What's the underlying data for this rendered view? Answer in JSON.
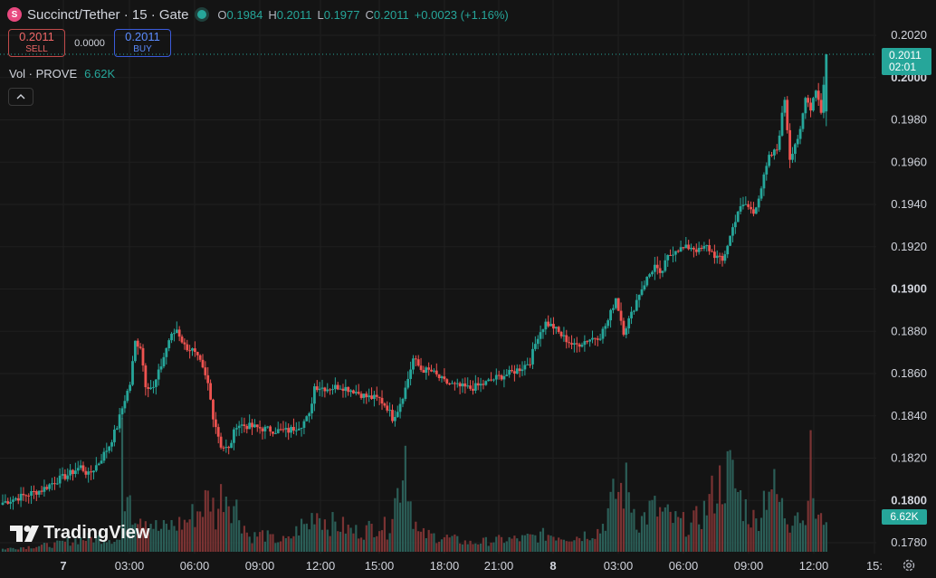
{
  "header": {
    "logo_letter": "S",
    "title": "Succinct/Tether · 15 · Gate",
    "ohlc": [
      {
        "key": "O",
        "value": "0.1984"
      },
      {
        "key": "H",
        "value": "0.2011"
      },
      {
        "key": "L",
        "value": "0.1977"
      },
      {
        "key": "C",
        "value": "0.2011"
      }
    ],
    "change": "+0.0023 (+1.16%)"
  },
  "trade": {
    "sell_price": "0.2011",
    "sell_label": "SELL",
    "spread": "0.0000",
    "buy_price": "0.2011",
    "buy_label": "BUY"
  },
  "volume_legend": {
    "name": "Vol · PROVE",
    "value": "6.62K"
  },
  "collapse_icon": "chevron-up-icon",
  "last_price_tag": {
    "price": "0.2011",
    "countdown": "02:01"
  },
  "volume_tag": "6.62K",
  "branding": "TradingView",
  "colors": {
    "up": "#26a69a",
    "down": "#ef5350",
    "up_vol": "#2b5e57",
    "down_vol": "#7a3333",
    "background": "#141414"
  },
  "chart_data": {
    "type": "candlestick",
    "interval": "15",
    "y_axis": {
      "min": 0.177,
      "max": 0.2025,
      "ticks": [
        "0.1780",
        "0.1800",
        "0.1820",
        "0.1840",
        "0.1860",
        "0.1880",
        "0.1900",
        "0.1920",
        "0.1940",
        "0.1960",
        "0.1980",
        "0.2000",
        "0.2020"
      ],
      "bold_ticks": [
        "0.1800",
        "0.1900",
        "0.2000"
      ]
    },
    "x_axis": {
      "ticks": [
        "7",
        "03:00",
        "06:00",
        "09:00",
        "12:00",
        "15:00",
        "18:00",
        "21:00",
        "8",
        "03:00",
        "06:00",
        "09:00",
        "12:00",
        "15:"
      ],
      "bold_ticks": [
        "7",
        "8"
      ]
    },
    "keyframes": [
      [
        0,
        0.1799
      ],
      [
        5,
        0.1801
      ],
      [
        10,
        0.1803
      ],
      [
        15,
        0.1805
      ],
      [
        20,
        0.1809
      ],
      [
        25,
        0.1812
      ],
      [
        30,
        0.1816
      ],
      [
        33,
        0.1812
      ],
      [
        37,
        0.1818
      ],
      [
        41,
        0.1826
      ],
      [
        44,
        0.1835
      ],
      [
        47,
        0.1848
      ],
      [
        49,
        0.1855
      ],
      [
        51,
        0.1875
      ],
      [
        53,
        0.1873
      ],
      [
        55,
        0.1855
      ],
      [
        58,
        0.1853
      ],
      [
        61,
        0.1864
      ],
      [
        64,
        0.1876
      ],
      [
        67,
        0.1881
      ],
      [
        70,
        0.1873
      ],
      [
        73,
        0.1871
      ],
      [
        76,
        0.1865
      ],
      [
        79,
        0.1855
      ],
      [
        81,
        0.184
      ],
      [
        84,
        0.1826
      ],
      [
        87,
        0.1824
      ],
      [
        90,
        0.1836
      ],
      [
        95,
        0.1835
      ],
      [
        100,
        0.1834
      ],
      [
        105,
        0.1833
      ],
      [
        110,
        0.1833
      ],
      [
        115,
        0.1836
      ],
      [
        118,
        0.184
      ],
      [
        120,
        0.1854
      ],
      [
        125,
        0.1853
      ],
      [
        130,
        0.1854
      ],
      [
        135,
        0.1852
      ],
      [
        140,
        0.1849
      ],
      [
        145,
        0.1848
      ],
      [
        148,
        0.1844
      ],
      [
        150,
        0.1839
      ],
      [
        152,
        0.1843
      ],
      [
        155,
        0.1853
      ],
      [
        158,
        0.1867
      ],
      [
        161,
        0.1862
      ],
      [
        165,
        0.1861
      ],
      [
        170,
        0.1856
      ],
      [
        175,
        0.1854
      ],
      [
        180,
        0.1853
      ],
      [
        185,
        0.1855
      ],
      [
        190,
        0.1858
      ],
      [
        195,
        0.186
      ],
      [
        200,
        0.1863
      ],
      [
        203,
        0.1866
      ],
      [
        206,
        0.1878
      ],
      [
        209,
        0.1884
      ],
      [
        212,
        0.1882
      ],
      [
        215,
        0.1878
      ],
      [
        220,
        0.1873
      ],
      [
        225,
        0.1876
      ],
      [
        230,
        0.1878
      ],
      [
        233,
        0.1885
      ],
      [
        236,
        0.1896
      ],
      [
        239,
        0.188
      ],
      [
        242,
        0.1888
      ],
      [
        245,
        0.1898
      ],
      [
        248,
        0.1905
      ],
      [
        251,
        0.1911
      ],
      [
        253,
        0.1906
      ],
      [
        256,
        0.1915
      ],
      [
        259,
        0.1919
      ],
      [
        262,
        0.1919
      ],
      [
        265,
        0.192
      ],
      [
        268,
        0.1918
      ],
      [
        271,
        0.192
      ],
      [
        274,
        0.1916
      ],
      [
        277,
        0.1913
      ],
      [
        280,
        0.1925
      ],
      [
        283,
        0.1937
      ],
      [
        286,
        0.194
      ],
      [
        289,
        0.1936
      ],
      [
        292,
        0.1948
      ],
      [
        295,
        0.1962
      ],
      [
        298,
        0.1966
      ],
      [
        301,
        0.199
      ],
      [
        303,
        0.1962
      ],
      [
        305,
        0.1969
      ],
      [
        307,
        0.1974
      ],
      [
        309,
        0.199
      ],
      [
        311,
        0.1986
      ],
      [
        313,
        0.1995
      ],
      [
        315,
        0.1984
      ],
      [
        317,
        0.2011
      ]
    ],
    "volume_profile": [
      [
        0,
        0.02
      ],
      [
        20,
        0.05
      ],
      [
        30,
        0.09
      ],
      [
        40,
        0.1
      ],
      [
        45,
        0.08
      ],
      [
        46,
        0.9
      ],
      [
        47,
        0.2
      ],
      [
        48,
        0.6
      ],
      [
        50,
        0.3
      ],
      [
        55,
        0.25
      ],
      [
        60,
        0.15
      ],
      [
        65,
        0.18
      ],
      [
        70,
        0.2
      ],
      [
        75,
        0.28
      ],
      [
        80,
        0.38
      ],
      [
        82,
        0.24
      ],
      [
        85,
        0.45
      ],
      [
        90,
        0.3
      ],
      [
        95,
        0.1
      ],
      [
        100,
        0.12
      ],
      [
        105,
        0.08
      ],
      [
        110,
        0.08
      ],
      [
        115,
        0.18
      ],
      [
        118,
        0.18
      ],
      [
        120,
        0.3
      ],
      [
        125,
        0.2
      ],
      [
        130,
        0.18
      ],
      [
        135,
        0.14
      ],
      [
        140,
        0.15
      ],
      [
        145,
        0.2
      ],
      [
        148,
        0.15
      ],
      [
        150,
        0.3
      ],
      [
        152,
        0.4
      ],
      [
        155,
        0.75
      ],
      [
        157,
        0.35
      ],
      [
        160,
        0.12
      ],
      [
        170,
        0.1
      ],
      [
        180,
        0.06
      ],
      [
        190,
        0.08
      ],
      [
        200,
        0.09
      ],
      [
        210,
        0.12
      ],
      [
        220,
        0.1
      ],
      [
        230,
        0.15
      ],
      [
        236,
        0.4
      ],
      [
        240,
        0.45
      ],
      [
        245,
        0.2
      ],
      [
        250,
        0.3
      ],
      [
        255,
        0.25
      ],
      [
        260,
        0.2
      ],
      [
        265,
        0.18
      ],
      [
        270,
        0.28
      ],
      [
        275,
        0.45
      ],
      [
        280,
        0.55
      ],
      [
        283,
        0.4
      ],
      [
        286,
        0.3
      ],
      [
        290,
        0.2
      ],
      [
        295,
        0.5
      ],
      [
        300,
        0.3
      ],
      [
        303,
        0.2
      ],
      [
        305,
        0.35
      ],
      [
        308,
        0.2
      ],
      [
        311,
        0.6
      ],
      [
        313,
        0.25
      ],
      [
        315,
        0.2
      ],
      [
        317,
        0.3
      ]
    ]
  }
}
